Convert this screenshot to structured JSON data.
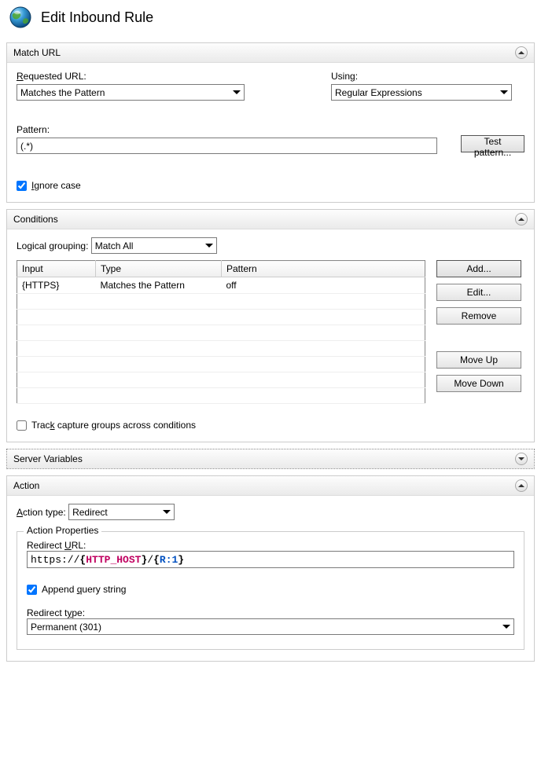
{
  "page": {
    "title": "Edit Inbound Rule"
  },
  "match_url": {
    "section_title": "Match URL",
    "requested_url_label": "Requested URL:",
    "requested_url_value": "Matches the Pattern",
    "using_label": "Using:",
    "using_value": "Regular Expressions",
    "pattern_label": "Pattern:",
    "pattern_value": "(.*)",
    "test_pattern_label": "Test pattern...",
    "ignore_case_label": "Ignore case",
    "ignore_case_checked": true
  },
  "conditions": {
    "section_title": "Conditions",
    "logical_grouping_label": "Logical grouping:",
    "logical_grouping_value": "Match All",
    "columns": {
      "input": "Input",
      "type": "Type",
      "pattern": "Pattern"
    },
    "rows": [
      {
        "input": "{HTTPS}",
        "type": "Matches the Pattern",
        "pattern": "off"
      }
    ],
    "buttons": {
      "add": "Add...",
      "edit": "Edit...",
      "remove": "Remove",
      "move_up": "Move Up",
      "move_down": "Move Down"
    },
    "track_capture_label": "Track capture groups across conditions",
    "track_capture_checked": false
  },
  "server_variables": {
    "section_title": "Server Variables"
  },
  "action": {
    "section_title": "Action",
    "action_type_label": "Action type:",
    "action_type_value": "Redirect",
    "properties_legend": "Action Properties",
    "redirect_url_label": "Redirect URL:",
    "redirect_url_tokens": {
      "prefix": "https://",
      "var": "HTTP_HOST",
      "mid": "/",
      "ref": "R:1"
    },
    "append_qs_label": "Append query string",
    "append_qs_checked": true,
    "redirect_type_label": "Redirect type:",
    "redirect_type_value": "Permanent (301)"
  }
}
